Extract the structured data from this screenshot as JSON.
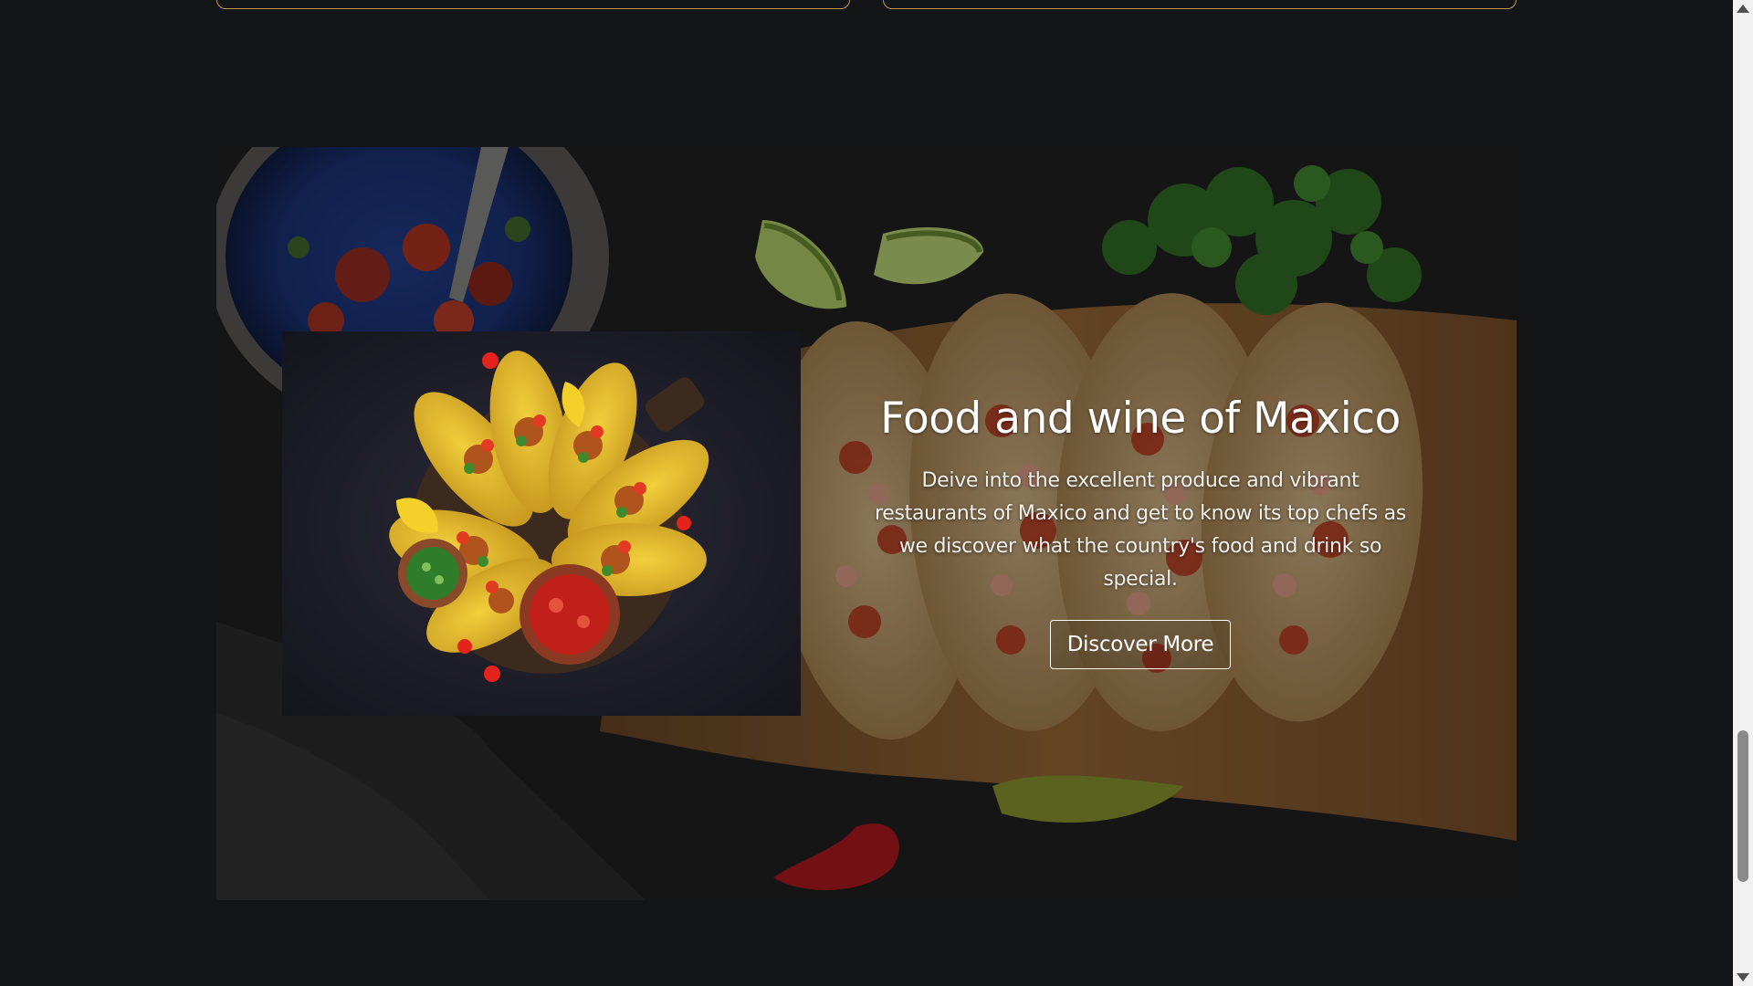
{
  "hero": {
    "title": "Food and wine of Maxico",
    "description": "Deive into the excellent produce and vibrant restaurants of Maxico and get to know its top chefs as we discover what the country's food and drink so special.",
    "button_label": "Discover More",
    "background_image": "tacos-on-wooden-board-photo",
    "inset_image": "tacos-platter-with-salsa-photo"
  },
  "colors": {
    "page_background": "#141517",
    "card_border": "#b59a55",
    "text": "#ffffff"
  },
  "scrollbar": {
    "icons": [
      "scroll-up-arrow-icon",
      "scroll-down-arrow-icon"
    ]
  }
}
